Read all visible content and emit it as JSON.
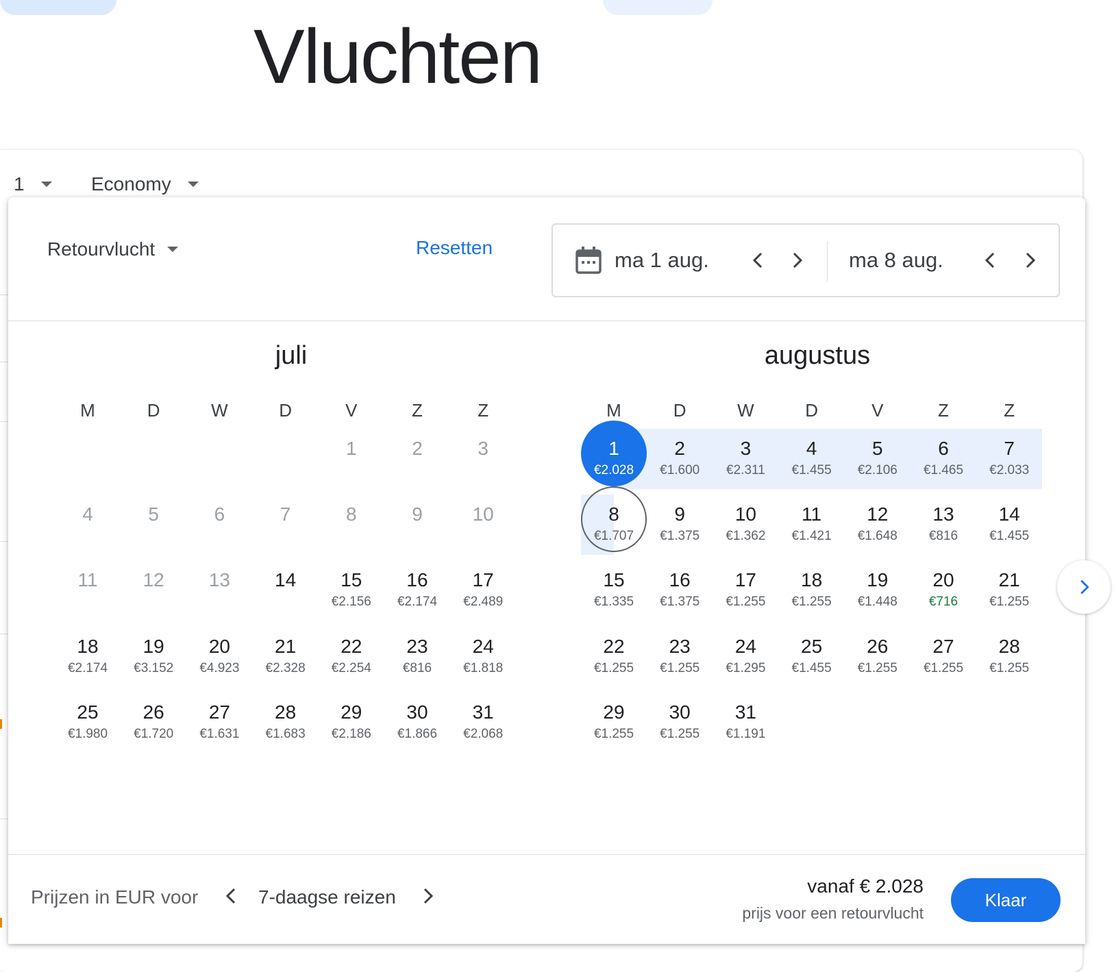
{
  "page": {
    "title": "Vluchten"
  },
  "search": {
    "passengers": "1",
    "cabin_class": "Economy"
  },
  "dialog": {
    "trip_type": "Retourvlucht",
    "reset_label": "Resetten",
    "departure_date": "ma 1 aug.",
    "return_date": "ma 8 aug."
  },
  "weekdays": [
    "M",
    "D",
    "W",
    "D",
    "V",
    "Z",
    "Z"
  ],
  "months": [
    {
      "name": "juli",
      "days": [
        {
          "num": "1",
          "price": "",
          "state": "past"
        },
        {
          "num": "2",
          "price": "",
          "state": "past"
        },
        {
          "num": "3",
          "price": "",
          "state": "past"
        },
        {
          "num": "4",
          "price": "",
          "state": "past"
        },
        {
          "num": "5",
          "price": "",
          "state": "past"
        },
        {
          "num": "6",
          "price": "",
          "state": "past"
        },
        {
          "num": "7",
          "price": "",
          "state": "past"
        },
        {
          "num": "8",
          "price": "",
          "state": "past"
        },
        {
          "num": "9",
          "price": "",
          "state": "past"
        },
        {
          "num": "10",
          "price": "",
          "state": "past"
        },
        {
          "num": "11",
          "price": "",
          "state": "past"
        },
        {
          "num": "12",
          "price": "",
          "state": "past"
        },
        {
          "num": "13",
          "price": "",
          "state": "past"
        },
        {
          "num": "14",
          "price": "",
          "state": ""
        },
        {
          "num": "15",
          "price": "€2.156",
          "state": ""
        },
        {
          "num": "16",
          "price": "€2.174",
          "state": ""
        },
        {
          "num": "17",
          "price": "€2.489",
          "state": ""
        },
        {
          "num": "18",
          "price": "€2.174",
          "state": ""
        },
        {
          "num": "19",
          "price": "€3.152",
          "state": ""
        },
        {
          "num": "20",
          "price": "€4.923",
          "state": ""
        },
        {
          "num": "21",
          "price": "€2.328",
          "state": ""
        },
        {
          "num": "22",
          "price": "€2.254",
          "state": ""
        },
        {
          "num": "23",
          "price": "€816",
          "state": ""
        },
        {
          "num": "24",
          "price": "€1.818",
          "state": ""
        },
        {
          "num": "25",
          "price": "€1.980",
          "state": ""
        },
        {
          "num": "26",
          "price": "€1.720",
          "state": ""
        },
        {
          "num": "27",
          "price": "€1.631",
          "state": ""
        },
        {
          "num": "28",
          "price": "€1.683",
          "state": ""
        },
        {
          "num": "29",
          "price": "€2.186",
          "state": ""
        },
        {
          "num": "30",
          "price": "€1.866",
          "state": ""
        },
        {
          "num": "31",
          "price": "€2.068",
          "state": ""
        }
      ]
    },
    {
      "name": "augustus",
      "days": [
        {
          "num": "1",
          "price": "€2.028",
          "state": "sel-start"
        },
        {
          "num": "2",
          "price": "€1.600",
          "state": ""
        },
        {
          "num": "3",
          "price": "€2.311",
          "state": ""
        },
        {
          "num": "4",
          "price": "€1.455",
          "state": ""
        },
        {
          "num": "5",
          "price": "€2.106",
          "state": ""
        },
        {
          "num": "6",
          "price": "€1.465",
          "state": ""
        },
        {
          "num": "7",
          "price": "€2.033",
          "state": ""
        },
        {
          "num": "8",
          "price": "€1.707",
          "state": "sel-end"
        },
        {
          "num": "9",
          "price": "€1.375",
          "state": ""
        },
        {
          "num": "10",
          "price": "€1.362",
          "state": ""
        },
        {
          "num": "11",
          "price": "€1.421",
          "state": ""
        },
        {
          "num": "12",
          "price": "€1.648",
          "state": ""
        },
        {
          "num": "13",
          "price": "€816",
          "state": ""
        },
        {
          "num": "14",
          "price": "€1.455",
          "state": ""
        },
        {
          "num": "15",
          "price": "€1.335",
          "state": ""
        },
        {
          "num": "16",
          "price": "€1.375",
          "state": ""
        },
        {
          "num": "17",
          "price": "€1.255",
          "state": ""
        },
        {
          "num": "18",
          "price": "€1.255",
          "state": ""
        },
        {
          "num": "19",
          "price": "€1.448",
          "state": ""
        },
        {
          "num": "20",
          "price": "€716",
          "state": "low"
        },
        {
          "num": "21",
          "price": "€1.255",
          "state": ""
        },
        {
          "num": "22",
          "price": "€1.255",
          "state": ""
        },
        {
          "num": "23",
          "price": "€1.255",
          "state": ""
        },
        {
          "num": "24",
          "price": "€1.295",
          "state": ""
        },
        {
          "num": "25",
          "price": "€1.455",
          "state": ""
        },
        {
          "num": "26",
          "price": "€1.255",
          "state": ""
        },
        {
          "num": "27",
          "price": "€1.255",
          "state": ""
        },
        {
          "num": "28",
          "price": "€1.255",
          "state": ""
        },
        {
          "num": "29",
          "price": "€1.255",
          "state": ""
        },
        {
          "num": "30",
          "price": "€1.255",
          "state": ""
        },
        {
          "num": "31",
          "price": "€1.191",
          "state": ""
        }
      ]
    }
  ],
  "footer": {
    "price_prefix": "Prijzen in EUR voor",
    "trip_duration": "7-daagse reizen",
    "from_price": "vanaf € 2.028",
    "from_price_sub": "prijs voor een retourvlucht",
    "done_label": "Klaar"
  },
  "colors": {
    "accent": "#1a73e8",
    "range": "#e8f0fe",
    "low_price": "#188038",
    "past_day": "#9aa0a6"
  },
  "icons": [
    "calendar-icon",
    "chevron-left-icon",
    "chevron-right-icon",
    "caret-down-icon"
  ]
}
